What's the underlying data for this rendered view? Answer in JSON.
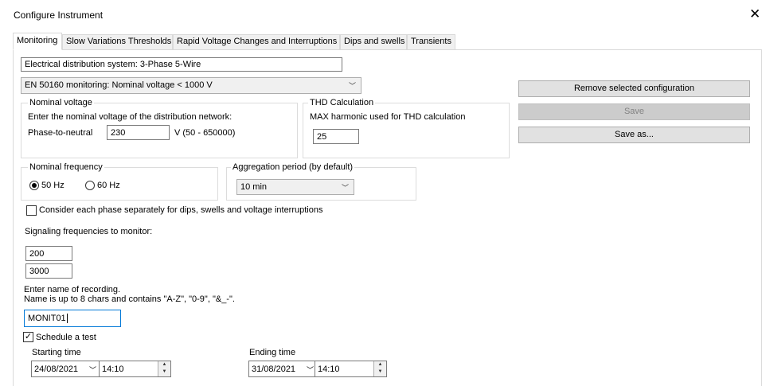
{
  "window": {
    "title": "Configure Instrument"
  },
  "tabs": [
    {
      "label": "Monitoring"
    },
    {
      "label": "Slow Variations Thresholds"
    },
    {
      "label": "Rapid Voltage Changes and Interruptions"
    },
    {
      "label": "Dips and swells"
    },
    {
      "label": "Transients"
    }
  ],
  "monitoring": {
    "distribution_system": "Electrical distribution system: 3-Phase 5-Wire",
    "en50160_selected": "EN 50160 monitoring: Nominal voltage < 1000 V",
    "nominal_voltage": {
      "legend": "Nominal voltage",
      "instruction": "Enter the nominal voltage of the distribution network:",
      "phase_label": "Phase-to-neutral",
      "value": "230",
      "unit_range": "V (50 - 650000)"
    },
    "thd": {
      "legend": "THD Calculation",
      "label": "MAX harmonic used for THD calculation",
      "value": "25"
    },
    "frequency": {
      "legend": "Nominal frequency",
      "options": [
        "50 Hz",
        "60 Hz"
      ],
      "selected": "50 Hz"
    },
    "aggregation": {
      "legend": "Aggregation period (by default)",
      "selected": "10 min"
    },
    "consider_phases_label": "Consider each phase separately for dips, swells and voltage interruptions",
    "consider_phases_checked": false,
    "signaling_label": "Signaling frequencies to monitor:",
    "signaling_values": [
      "200",
      "3000"
    ],
    "recording_instruction_1": "Enter name of recording.",
    "recording_instruction_2": "Name is up to 8 chars and contains \"A-Z\", \"0-9\", \"&_-\".",
    "recording_name": "MONIT01",
    "schedule_label": "Schedule a test",
    "schedule_checked": true,
    "start": {
      "label": "Starting time",
      "date": "24/08/2021",
      "time": "14:10"
    },
    "end": {
      "label": "Ending time",
      "date": "31/08/2021",
      "time": "14:10"
    }
  },
  "buttons": {
    "remove": "Remove selected configuration",
    "save": "Save",
    "save_as": "Save as..."
  },
  "icons": {
    "close": "✕",
    "chevron": "﹀",
    "check": "✓",
    "spin_up": "▲",
    "spin_down": "▼"
  }
}
